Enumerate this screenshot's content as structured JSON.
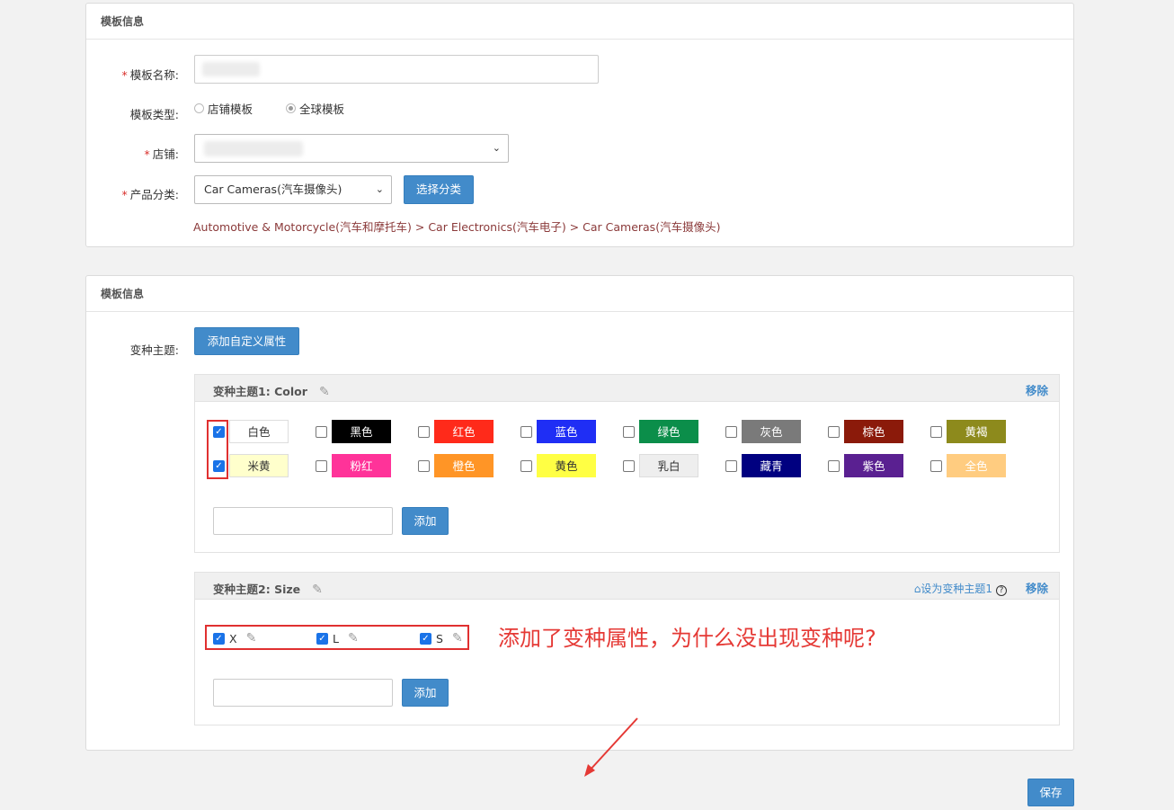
{
  "panel1": {
    "title": "模板信息",
    "name_label": "模板名称:",
    "type_label": "模板类型:",
    "type_options": [
      "店铺模板",
      "全球模板"
    ],
    "store_label": "店铺:",
    "category_label": "产品分类:",
    "category_value": "Car Cameras(汽车摄像头)",
    "choose_category_button": "选择分类",
    "breadcrumb": "Automotive & Motorcycle(汽车和摩托车) > Car Electronics(汽车电子) > Car Cameras(汽车摄像头)",
    "required_mark": "*"
  },
  "panel2": {
    "title": "模板信息",
    "variant_label": "变种主题:",
    "add_custom_button": "添加自定义属性",
    "theme1": {
      "title": "变种主题1:",
      "name": "Color",
      "remove": "移除",
      "add_button": "添加",
      "colors": [
        {
          "label": "白色",
          "bg": "#ffffff",
          "fg": "#333333",
          "checked": true
        },
        {
          "label": "黑色",
          "bg": "#000000",
          "fg": "#ffffff",
          "checked": false
        },
        {
          "label": "红色",
          "bg": "#ff2a1a",
          "fg": "#ffffff",
          "checked": false
        },
        {
          "label": "蓝色",
          "bg": "#1f2ef5",
          "fg": "#ffffff",
          "checked": false
        },
        {
          "label": "绿色",
          "bg": "#0b8e4a",
          "fg": "#ffffff",
          "checked": false
        },
        {
          "label": "灰色",
          "bg": "#7a7a7a",
          "fg": "#ffffff",
          "checked": false
        },
        {
          "label": "棕色",
          "bg": "#8b1a0a",
          "fg": "#ffffff",
          "checked": false
        },
        {
          "label": "黄褐",
          "bg": "#8d8a1c",
          "fg": "#ffffff",
          "checked": false
        },
        {
          "label": "米黄",
          "bg": "#ffffcc",
          "fg": "#333333",
          "checked": true
        },
        {
          "label": "粉红",
          "bg": "#ff3399",
          "fg": "#ffffff",
          "checked": false
        },
        {
          "label": "橙色",
          "bg": "#ff9526",
          "fg": "#ffffff",
          "checked": false
        },
        {
          "label": "黄色",
          "bg": "#ffff44",
          "fg": "#333333",
          "checked": false
        },
        {
          "label": "乳白",
          "bg": "#eeeeee",
          "fg": "#333333",
          "checked": false
        },
        {
          "label": "藏青",
          "bg": "#000080",
          "fg": "#ffffff",
          "checked": false
        },
        {
          "label": "紫色",
          "bg": "#5a2091",
          "fg": "#ffffff",
          "checked": false
        },
        {
          "label": "全色",
          "bg": "#ffcc80",
          "fg": "#ffffff",
          "checked": false
        }
      ]
    },
    "theme2": {
      "title": "变种主题2:",
      "name": "Size",
      "set_main": "设为变种主题1",
      "help": "?",
      "remove": "移除",
      "add_button": "添加",
      "sizes": [
        {
          "label": "X",
          "checked": true
        },
        {
          "label": "L",
          "checked": true
        },
        {
          "label": "S",
          "checked": true
        }
      ]
    }
  },
  "annotation": "添加了变种属性，为什么没出现变种呢?",
  "save_button": "保存",
  "icons": {
    "edit": "pencil-icon",
    "home": "home-icon",
    "dropdown": "chevron-down-icon",
    "check": "check-icon"
  },
  "colors": {
    "accent": "#428bca",
    "annotation": "#e53935",
    "breadcrumb": "#8b3a3a"
  }
}
